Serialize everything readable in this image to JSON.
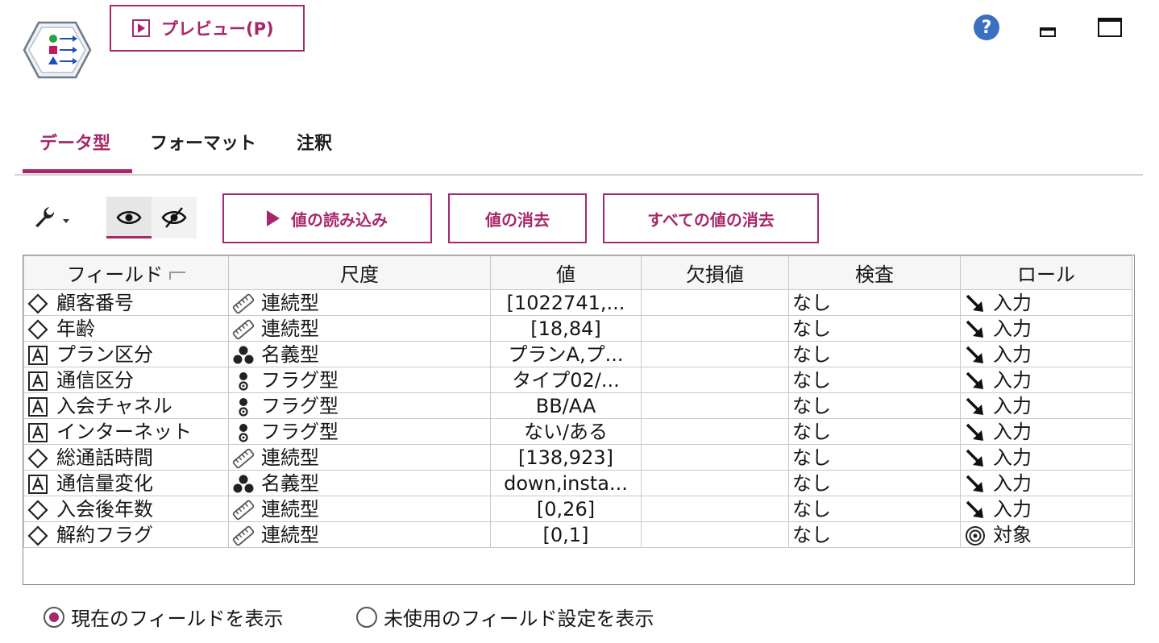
{
  "toolbar": {
    "preview_label": "プレビュー(P)",
    "help_glyph": "?"
  },
  "tabs": [
    {
      "label": "データ型",
      "active": true
    },
    {
      "label": "フォーマット",
      "active": false
    },
    {
      "label": "注釈",
      "active": false
    }
  ],
  "actions": {
    "read_values": "値の読み込み",
    "clear_values": "値の消去",
    "clear_all_values": "すべての値の消去"
  },
  "table": {
    "columns": [
      "フィールド",
      "尺度",
      "値",
      "欠損値",
      "検査",
      "ロール"
    ],
    "rows": [
      {
        "field": "顧客番号",
        "field_icon": "continuous-field-icon",
        "measure": "連続型",
        "measure_icon": "continuous-measure-icon",
        "values": "[1022741,...",
        "missing": "",
        "check": "なし",
        "role": "入力",
        "role_icon": "input-role-icon"
      },
      {
        "field": "年齢",
        "field_icon": "continuous-field-icon",
        "measure": "連続型",
        "measure_icon": "continuous-measure-icon",
        "values": "[18,84]",
        "missing": "",
        "check": "なし",
        "role": "入力",
        "role_icon": "input-role-icon"
      },
      {
        "field": "プラン区分",
        "field_icon": "string-field-icon",
        "measure": "名義型",
        "measure_icon": "nominal-measure-icon",
        "values": "プランA,プ...",
        "missing": "",
        "check": "なし",
        "role": "入力",
        "role_icon": "input-role-icon"
      },
      {
        "field": "通信区分",
        "field_icon": "string-field-icon",
        "measure": "フラグ型",
        "measure_icon": "flag-measure-icon",
        "values": "タイプ02/...",
        "missing": "",
        "check": "なし",
        "role": "入力",
        "role_icon": "input-role-icon"
      },
      {
        "field": "入会チャネル",
        "field_icon": "string-field-icon",
        "measure": "フラグ型",
        "measure_icon": "flag-measure-icon",
        "values": "BB/AA",
        "missing": "",
        "check": "なし",
        "role": "入力",
        "role_icon": "input-role-icon"
      },
      {
        "field": "インターネット",
        "field_icon": "string-field-icon",
        "measure": "フラグ型",
        "measure_icon": "flag-measure-icon",
        "values": "ない/ある",
        "missing": "",
        "check": "なし",
        "role": "入力",
        "role_icon": "input-role-icon"
      },
      {
        "field": "総通話時間",
        "field_icon": "continuous-field-icon",
        "measure": "連続型",
        "measure_icon": "continuous-measure-icon",
        "values": "[138,923]",
        "missing": "",
        "check": "なし",
        "role": "入力",
        "role_icon": "input-role-icon"
      },
      {
        "field": "通信量変化",
        "field_icon": "string-field-icon",
        "measure": "名義型",
        "measure_icon": "nominal-measure-icon",
        "values": "down,insta...",
        "missing": "",
        "check": "なし",
        "role": "入力",
        "role_icon": "input-role-icon"
      },
      {
        "field": "入会後年数",
        "field_icon": "continuous-field-icon",
        "measure": "連続型",
        "measure_icon": "continuous-measure-icon",
        "values": "[0,26]",
        "missing": "",
        "check": "なし",
        "role": "入力",
        "role_icon": "input-role-icon"
      },
      {
        "field": "解約フラグ",
        "field_icon": "continuous-field-icon",
        "measure": "連続型",
        "measure_icon": "continuous-measure-icon",
        "values": "[0,1]",
        "missing": "",
        "check": "なし",
        "role": "対象",
        "role_icon": "target-role-icon"
      }
    ]
  },
  "display_options": [
    {
      "label": "現在のフィールドを表示",
      "selected": true
    },
    {
      "label": "未使用のフィールド設定を表示",
      "selected": false
    }
  ],
  "colors": {
    "accent": "#a6286a",
    "help_blue": "#3a6fc4"
  }
}
